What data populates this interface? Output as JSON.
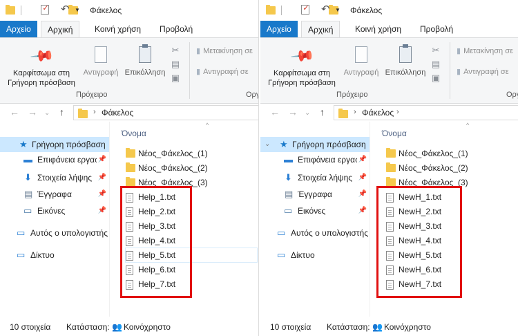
{
  "panes": [
    {
      "title": "Φάκελος",
      "tabs": [
        "Αρχείο",
        "Αρχική",
        "Κοινή χρήση",
        "Προβολή"
      ],
      "ribbon": {
        "pin_line1": "Καρφίτσωμα στη",
        "pin_line2": "Γρήγορη πρόσβαση",
        "copy": "Αντιγραφή",
        "paste": "Επικόλληση",
        "move_to": "Μετακίνηση σε",
        "copy_to": "Αντιγραφή σε",
        "clipboard_group": "Πρόχειρο",
        "organize_group": "Οργ"
      },
      "address": "Φάκελος",
      "nav": {
        "quick_access": "Γρήγορη πρόσβαση",
        "desktop": "Επιφάνεια εργασίας",
        "downloads": "Στοιχεία λήψης",
        "documents": "Έγγραφα",
        "pictures": "Εικόνες",
        "this_pc": "Αυτός ο υπολογιστής",
        "network": "Δίκτυο"
      },
      "column_header": "Όνομα",
      "folders": [
        "Νέος_Φάκελος_(1)",
        "Νέος_Φάκελος_(2)",
        "Νέος_Φάκελος_(3)"
      ],
      "files": [
        "Help_1.txt",
        "Help_2.txt",
        "Help_3.txt",
        "Help_4.txt",
        "Help_5.txt",
        "Help_6.txt",
        "Help_7.txt"
      ],
      "status": {
        "count": "10 στοιχεία",
        "state_label": "Κατάσταση:",
        "state_value": "Κοινόχρηστο"
      }
    },
    {
      "title": "Φάκελος",
      "tabs": [
        "Αρχείο",
        "Αρχική",
        "Κοινή χρήση",
        "Προβολή"
      ],
      "ribbon": {
        "pin_line1": "Καρφίτσωμα στη",
        "pin_line2": "Γρήγορη πρόσβαση",
        "copy": "Αντιγραφή",
        "paste": "Επικόλληση",
        "move_to": "Μετακίνηση σε",
        "copy_to": "Αντιγραφή σε",
        "clipboard_group": "Πρόχειρο",
        "organize_group": "Οργ"
      },
      "address": "Φάκελος",
      "nav": {
        "quick_access": "Γρήγορη πρόσβαση",
        "desktop": "Επιφάνεια εργασίας",
        "downloads": "Στοιχεία λήψης",
        "documents": "Έγγραφα",
        "pictures": "Εικόνες",
        "this_pc": "Αυτός ο υπολογιστής",
        "network": "Δίκτυο"
      },
      "column_header": "Όνομα",
      "folders": [
        "Νέος_Φάκελος_(1)",
        "Νέος_Φάκελος_(2)",
        "Νέος_Φάκελος_(3)"
      ],
      "files": [
        "NewH_1.txt",
        "NewH_2.txt",
        "NewH_3.txt",
        "NewH_4.txt",
        "NewH_5.txt",
        "NewH_6.txt",
        "NewH_7.txt"
      ],
      "status": {
        "count": "10 στοιχεία",
        "state_label": "Κατάσταση:",
        "state_value": "Κοινόχρηστο"
      }
    }
  ],
  "colors": {
    "file_tab": "#1979ca",
    "highlight_box": "#e11010",
    "selected_nav": "#cce8ff"
  },
  "icons": [
    "folder-icon",
    "properties-icon",
    "undo-icon",
    "pin-icon",
    "copy-icon",
    "paste-icon",
    "cut-icon",
    "back-arrow-icon",
    "forward-arrow-icon",
    "up-arrow-icon",
    "star-icon",
    "desktop-icon",
    "download-icon",
    "document-icon",
    "pictures-icon",
    "computer-icon",
    "network-icon",
    "text-file-icon",
    "shared-users-icon"
  ]
}
